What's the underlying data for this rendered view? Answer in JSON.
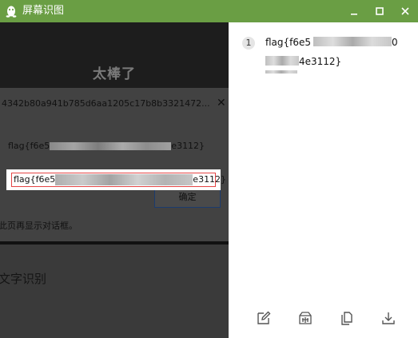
{
  "app": {
    "title": "屏幕识图",
    "controls": [
      "minimize-icon",
      "maximize-icon",
      "close-icon"
    ],
    "accent": "#6a9e44"
  },
  "screenshot": {
    "heading": "太棒了",
    "hash_line": "4342b80a941b785d6aa1205c17b8b3321472...",
    "flag_start": "flag{f6e5",
    "flag_end": "e3112}",
    "confirm_button": "确定",
    "no_more_dialog": "此页再显示对话框。",
    "ocr_label": "文字识别"
  },
  "selection": {
    "flag_start": "flag{f6e5",
    "flag_end": "e3112}"
  },
  "result": {
    "index": "1",
    "line1_start": "flag{f6e5",
    "line1_end": "0",
    "line2_end": "4e3112}"
  },
  "toolbar": {
    "edit": "edit-icon",
    "translate": "translate-icon",
    "copy": "copy-icon",
    "download": "download-icon"
  }
}
